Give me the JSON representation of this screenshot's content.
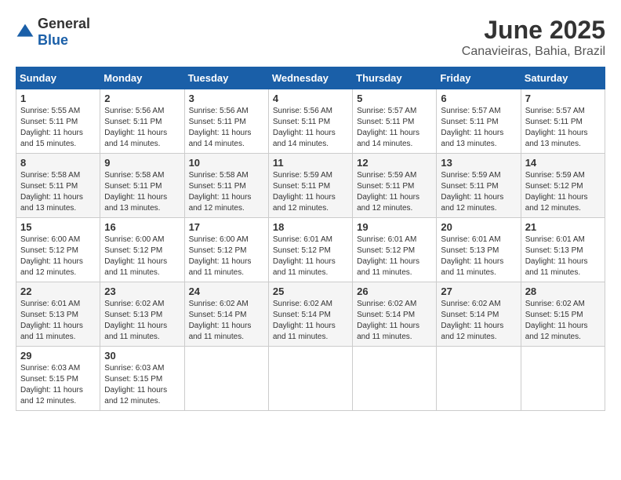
{
  "header": {
    "logo_general": "General",
    "logo_blue": "Blue",
    "month_title": "June 2025",
    "location": "Canavieiras, Bahia, Brazil"
  },
  "weekdays": [
    "Sunday",
    "Monday",
    "Tuesday",
    "Wednesday",
    "Thursday",
    "Friday",
    "Saturday"
  ],
  "weeks": [
    [
      {
        "day": "1",
        "sunrise": "Sunrise: 5:55 AM",
        "sunset": "Sunset: 5:11 PM",
        "daylight": "Daylight: 11 hours and 15 minutes."
      },
      {
        "day": "2",
        "sunrise": "Sunrise: 5:56 AM",
        "sunset": "Sunset: 5:11 PM",
        "daylight": "Daylight: 11 hours and 14 minutes."
      },
      {
        "day": "3",
        "sunrise": "Sunrise: 5:56 AM",
        "sunset": "Sunset: 5:11 PM",
        "daylight": "Daylight: 11 hours and 14 minutes."
      },
      {
        "day": "4",
        "sunrise": "Sunrise: 5:56 AM",
        "sunset": "Sunset: 5:11 PM",
        "daylight": "Daylight: 11 hours and 14 minutes."
      },
      {
        "day": "5",
        "sunrise": "Sunrise: 5:57 AM",
        "sunset": "Sunset: 5:11 PM",
        "daylight": "Daylight: 11 hours and 14 minutes."
      },
      {
        "day": "6",
        "sunrise": "Sunrise: 5:57 AM",
        "sunset": "Sunset: 5:11 PM",
        "daylight": "Daylight: 11 hours and 13 minutes."
      },
      {
        "day": "7",
        "sunrise": "Sunrise: 5:57 AM",
        "sunset": "Sunset: 5:11 PM",
        "daylight": "Daylight: 11 hours and 13 minutes."
      }
    ],
    [
      {
        "day": "8",
        "sunrise": "Sunrise: 5:58 AM",
        "sunset": "Sunset: 5:11 PM",
        "daylight": "Daylight: 11 hours and 13 minutes."
      },
      {
        "day": "9",
        "sunrise": "Sunrise: 5:58 AM",
        "sunset": "Sunset: 5:11 PM",
        "daylight": "Daylight: 11 hours and 13 minutes."
      },
      {
        "day": "10",
        "sunrise": "Sunrise: 5:58 AM",
        "sunset": "Sunset: 5:11 PM",
        "daylight": "Daylight: 11 hours and 12 minutes."
      },
      {
        "day": "11",
        "sunrise": "Sunrise: 5:59 AM",
        "sunset": "Sunset: 5:11 PM",
        "daylight": "Daylight: 11 hours and 12 minutes."
      },
      {
        "day": "12",
        "sunrise": "Sunrise: 5:59 AM",
        "sunset": "Sunset: 5:11 PM",
        "daylight": "Daylight: 11 hours and 12 minutes."
      },
      {
        "day": "13",
        "sunrise": "Sunrise: 5:59 AM",
        "sunset": "Sunset: 5:11 PM",
        "daylight": "Daylight: 11 hours and 12 minutes."
      },
      {
        "day": "14",
        "sunrise": "Sunrise: 5:59 AM",
        "sunset": "Sunset: 5:12 PM",
        "daylight": "Daylight: 11 hours and 12 minutes."
      }
    ],
    [
      {
        "day": "15",
        "sunrise": "Sunrise: 6:00 AM",
        "sunset": "Sunset: 5:12 PM",
        "daylight": "Daylight: 11 hours and 12 minutes."
      },
      {
        "day": "16",
        "sunrise": "Sunrise: 6:00 AM",
        "sunset": "Sunset: 5:12 PM",
        "daylight": "Daylight: 11 hours and 11 minutes."
      },
      {
        "day": "17",
        "sunrise": "Sunrise: 6:00 AM",
        "sunset": "Sunset: 5:12 PM",
        "daylight": "Daylight: 11 hours and 11 minutes."
      },
      {
        "day": "18",
        "sunrise": "Sunrise: 6:01 AM",
        "sunset": "Sunset: 5:12 PM",
        "daylight": "Daylight: 11 hours and 11 minutes."
      },
      {
        "day": "19",
        "sunrise": "Sunrise: 6:01 AM",
        "sunset": "Sunset: 5:12 PM",
        "daylight": "Daylight: 11 hours and 11 minutes."
      },
      {
        "day": "20",
        "sunrise": "Sunrise: 6:01 AM",
        "sunset": "Sunset: 5:13 PM",
        "daylight": "Daylight: 11 hours and 11 minutes."
      },
      {
        "day": "21",
        "sunrise": "Sunrise: 6:01 AM",
        "sunset": "Sunset: 5:13 PM",
        "daylight": "Daylight: 11 hours and 11 minutes."
      }
    ],
    [
      {
        "day": "22",
        "sunrise": "Sunrise: 6:01 AM",
        "sunset": "Sunset: 5:13 PM",
        "daylight": "Daylight: 11 hours and 11 minutes."
      },
      {
        "day": "23",
        "sunrise": "Sunrise: 6:02 AM",
        "sunset": "Sunset: 5:13 PM",
        "daylight": "Daylight: 11 hours and 11 minutes."
      },
      {
        "day": "24",
        "sunrise": "Sunrise: 6:02 AM",
        "sunset": "Sunset: 5:14 PM",
        "daylight": "Daylight: 11 hours and 11 minutes."
      },
      {
        "day": "25",
        "sunrise": "Sunrise: 6:02 AM",
        "sunset": "Sunset: 5:14 PM",
        "daylight": "Daylight: 11 hours and 11 minutes."
      },
      {
        "day": "26",
        "sunrise": "Sunrise: 6:02 AM",
        "sunset": "Sunset: 5:14 PM",
        "daylight": "Daylight: 11 hours and 11 minutes."
      },
      {
        "day": "27",
        "sunrise": "Sunrise: 6:02 AM",
        "sunset": "Sunset: 5:14 PM",
        "daylight": "Daylight: 11 hours and 12 minutes."
      },
      {
        "day": "28",
        "sunrise": "Sunrise: 6:02 AM",
        "sunset": "Sunset: 5:15 PM",
        "daylight": "Daylight: 11 hours and 12 minutes."
      }
    ],
    [
      {
        "day": "29",
        "sunrise": "Sunrise: 6:03 AM",
        "sunset": "Sunset: 5:15 PM",
        "daylight": "Daylight: 11 hours and 12 minutes."
      },
      {
        "day": "30",
        "sunrise": "Sunrise: 6:03 AM",
        "sunset": "Sunset: 5:15 PM",
        "daylight": "Daylight: 11 hours and 12 minutes."
      },
      null,
      null,
      null,
      null,
      null
    ]
  ]
}
